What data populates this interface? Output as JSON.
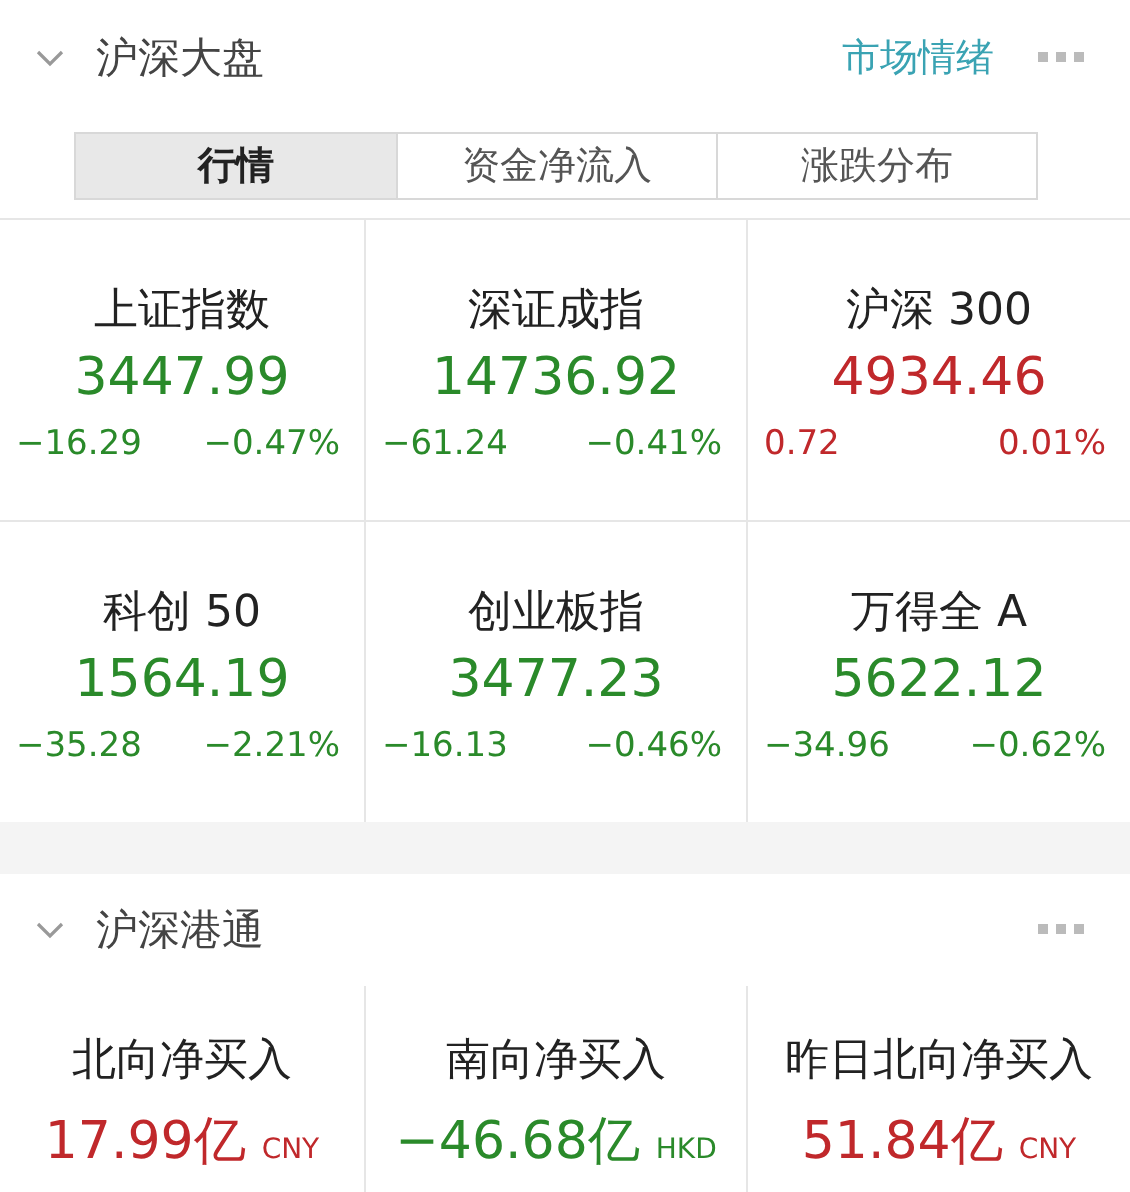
{
  "market": {
    "title": "沪深大盘",
    "link": "市场情绪",
    "tabs": [
      {
        "label": "行情",
        "selected": true
      },
      {
        "label": "资金净流入",
        "selected": false
      },
      {
        "label": "涨跌分布",
        "selected": false
      }
    ],
    "indices": [
      {
        "name": "上证指数",
        "value": "3447.99",
        "change": "−16.29",
        "percent": "−0.47%",
        "kind": "down"
      },
      {
        "name": "深证成指",
        "value": "14736.92",
        "change": "−61.24",
        "percent": "−0.41%",
        "kind": "down"
      },
      {
        "name": "沪深 300",
        "value": "4934.46",
        "change": "0.72",
        "percent": "0.01%",
        "kind": "up"
      },
      {
        "name": "科创 50",
        "value": "1564.19",
        "change": "−35.28",
        "percent": "−2.21%",
        "kind": "down"
      },
      {
        "name": "创业板指",
        "value": "3477.23",
        "change": "−16.13",
        "percent": "−0.46%",
        "kind": "down"
      },
      {
        "name": "万得全 A",
        "value": "5622.12",
        "change": "−34.96",
        "percent": "−0.62%",
        "kind": "down"
      }
    ]
  },
  "connect": {
    "title": "沪深港通",
    "flows": [
      {
        "name": "北向净买入",
        "value": "17.99亿",
        "currency": "CNY",
        "kind": "up"
      },
      {
        "name": "南向净买入",
        "value": "−46.68亿",
        "currency": "HKD",
        "kind": "down"
      },
      {
        "name": "昨日北向净买入",
        "value": "51.84亿",
        "currency": "CNY",
        "kind": "up"
      }
    ]
  }
}
